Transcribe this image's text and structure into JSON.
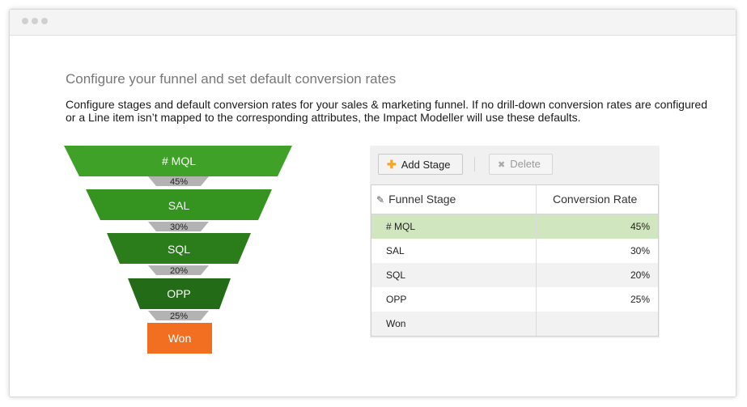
{
  "page": {
    "heading": "Configure your funnel and set default conversion rates",
    "description": "Configure stages and default conversion rates for your sales & marketing funnel. If no drill-down conversion rates are configured or a Line item isn’t mapped to the corresponding attributes, the Impact Modeller will use these defaults."
  },
  "funnel": {
    "stages": [
      {
        "label": "# MQL",
        "color": "#3fa128"
      },
      {
        "label": "SAL",
        "color": "#34941f"
      },
      {
        "label": "SQL",
        "color": "#2b7d1c"
      },
      {
        "label": "OPP",
        "color": "#236b17"
      },
      {
        "label": "Won",
        "color": "#f26f21"
      }
    ],
    "rates": [
      "45%",
      "30%",
      "20%",
      "25%"
    ]
  },
  "toolbar": {
    "add_label": "Add Stage",
    "delete_label": "Delete"
  },
  "table": {
    "col_stage": "Funnel Stage",
    "col_rate": "Conversion Rate",
    "selected_color": "#cfe6bf",
    "rows": [
      {
        "stage": "# MQL",
        "rate": "45%"
      },
      {
        "stage": "SAL",
        "rate": "30%"
      },
      {
        "stage": "SQL",
        "rate": "20%"
      },
      {
        "stage": "OPP",
        "rate": "25%"
      },
      {
        "stage": "Won",
        "rate": ""
      }
    ]
  }
}
